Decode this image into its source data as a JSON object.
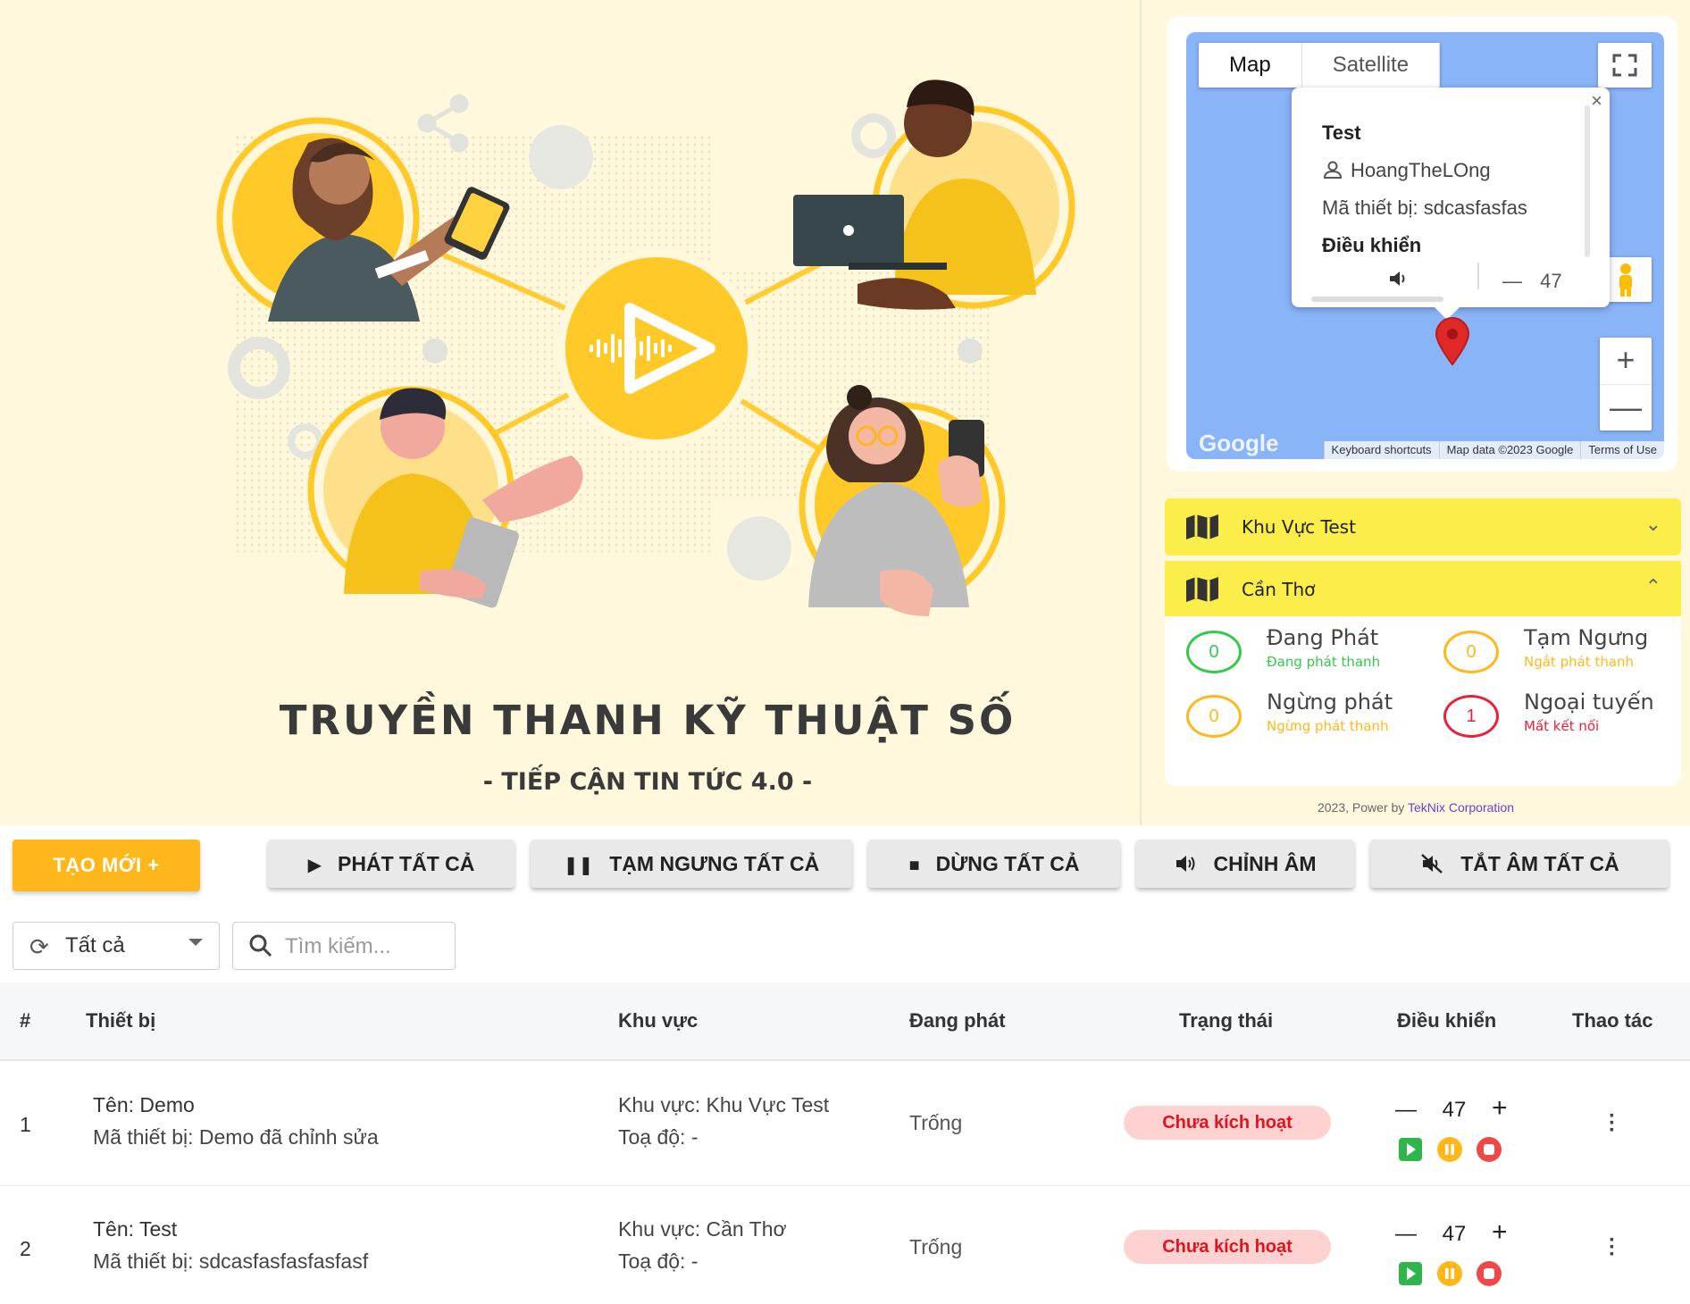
{
  "hero": {
    "title": "TRUYỀN THANH KỸ THUẬT SỐ",
    "subtitle": "- TIẾP CẬN TIN TỨC 4.0 -"
  },
  "map": {
    "types": [
      "Map",
      "Satellite"
    ],
    "active_type": "Map",
    "info": {
      "close": "×",
      "title": "Test",
      "user": "HoangTheLOng",
      "device_code": "Mã thiết bị: sdcasfasfas",
      "control_label": "Điều khiển",
      "minus": "—",
      "volume": "47"
    },
    "zoom_in": "+",
    "zoom_out": "—",
    "google": "Google",
    "attribution": [
      "Keyboard shortcuts",
      "Map data ©2023 Google",
      "Terms of Use"
    ]
  },
  "areas": [
    {
      "label": "Khu Vực Test",
      "chevron": "⌄"
    },
    {
      "label": "Cần Thơ",
      "chevron": "⌃"
    }
  ],
  "stats": [
    {
      "count": "0",
      "title": "Đang Phát",
      "sub": "Đang phát thanh",
      "color": "#35c84a"
    },
    {
      "count": "0",
      "title": "Tạm Ngưng",
      "sub": "Ngắt phát thanh",
      "color": "#ffb71b"
    },
    {
      "count": "0",
      "title": "Ngừng phát",
      "sub": "Ngừng phát thanh",
      "color": "#ffb71b"
    },
    {
      "count": "1",
      "title": "Ngoại tuyến",
      "sub": "Mất kết nối",
      "color": "#e8213b"
    }
  ],
  "footer": {
    "prefix": "2023, Power by",
    "company": "TekNix Corporation"
  },
  "actions": {
    "create": "TẠO MỚI  +",
    "play_all": "PHÁT TẤT CẢ",
    "pause_all": "TẠM NGƯNG TẤT CẢ",
    "stop_all": "DỪNG TẤT CẢ",
    "adjust_volume": "CHỈNH ÂM",
    "mute_all": "TẮT ÂM TẤT CẢ"
  },
  "filter": {
    "value": "Tất cả",
    "search_placeholder": "Tìm kiếm..."
  },
  "table": {
    "headers": [
      "#",
      "Thiết bị",
      "Khu vực",
      "Đang phát",
      "Trạng thái",
      "Điều khiển",
      "Thao tác"
    ],
    "rows": [
      {
        "index": "1",
        "name": "Tên: Demo",
        "code": "Mã thiết bị: Demo đã chỉnh sửa",
        "area": "Khu vực: Khu Vực Test",
        "coords": "Toạ độ: -",
        "playing": "Trống",
        "status": "Chưa kích hoạt",
        "minus": "—",
        "volume": "47",
        "plus": "+"
      },
      {
        "index": "2",
        "name": "Tên: Test",
        "code": "Mã thiết bị: sdcasfasfasfasfasf",
        "area": "Khu vực: Cần Thơ",
        "coords": "Toạ độ: -",
        "playing": "Trống",
        "status": "Chưa kích hoạt",
        "minus": "—",
        "volume": "47",
        "plus": "+"
      }
    ]
  },
  "colors": {
    "accent": "#ffb71b",
    "area_bar": "#fbee4a",
    "hero_bg": "#fff8dc",
    "danger": "#e0141e",
    "success": "#2fb64a"
  }
}
